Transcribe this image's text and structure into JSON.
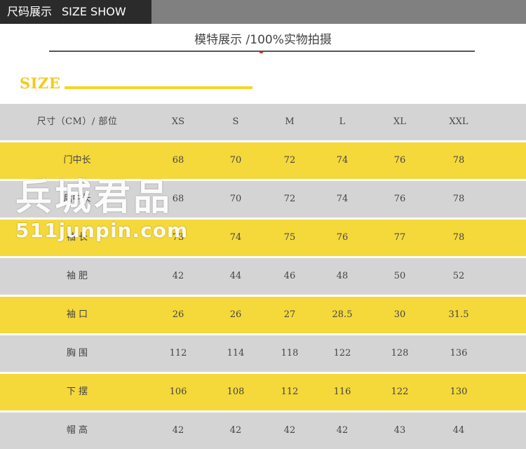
{
  "header": {
    "title_cn": "尺码展示",
    "title_en": "SIZE SHOW"
  },
  "subtitle": "模特展示 /100%实物拍摄",
  "size_label": "SIZE",
  "colors": {
    "dark_tab": "#2b2b2b",
    "topbar": "#808080",
    "accent_yellow": "#f5d83a",
    "row_grey": "#d4d4d4"
  },
  "table": {
    "columns": [
      "尺寸（CM）/ 部位",
      "XS",
      "S",
      "M",
      "L",
      "XL",
      "XXL"
    ],
    "rows": [
      {
        "label": "门中长",
        "values": [
          "68",
          "70",
          "72",
          "74",
          "76",
          "78"
        ]
      },
      {
        "label": "后中长",
        "values": [
          "68",
          "70",
          "72",
          "74",
          "76",
          "78"
        ]
      },
      {
        "label": "袖 长",
        "values": [
          "73",
          "74",
          "75",
          "76",
          "77",
          "78"
        ]
      },
      {
        "label": "袖 肥",
        "values": [
          "42",
          "44",
          "46",
          "48",
          "50",
          "52"
        ]
      },
      {
        "label": "袖 口",
        "values": [
          "26",
          "26",
          "27",
          "28.5",
          "30",
          "31.5"
        ]
      },
      {
        "label": "胸 围",
        "values": [
          "112",
          "114",
          "118",
          "122",
          "128",
          "136"
        ]
      },
      {
        "label": "下 摆",
        "values": [
          "106",
          "108",
          "112",
          "116",
          "122",
          "130"
        ]
      },
      {
        "label": "帽 高",
        "values": [
          "42",
          "42",
          "42",
          "42",
          "43",
          "44"
        ]
      }
    ]
  },
  "watermark": {
    "cn": "兵城君品",
    "url": "511junpin.com"
  }
}
